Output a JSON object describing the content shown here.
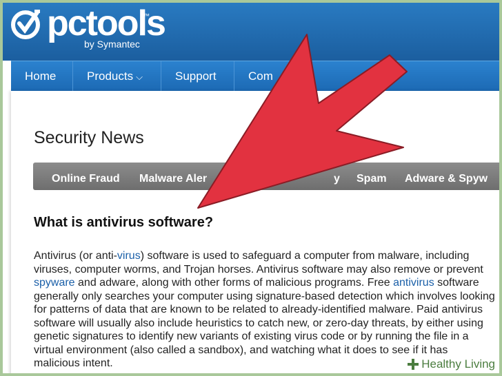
{
  "logo": {
    "name": "pctools",
    "trademark": "™",
    "byline": "by Symantec"
  },
  "nav": {
    "items": [
      {
        "label": "Home"
      },
      {
        "label": "Products"
      },
      {
        "label": "Support"
      },
      {
        "label": "Com"
      }
    ]
  },
  "page": {
    "title": "Security News"
  },
  "tabs": [
    {
      "label": "Online Fraud"
    },
    {
      "label": "Malware Aler"
    },
    {
      "label": "y"
    },
    {
      "label": "Spam"
    },
    {
      "label": "Adware & Spyw"
    }
  ],
  "article": {
    "title": "What is antivirus software?",
    "segments": [
      {
        "text": "Antivirus (or anti-",
        "link": false
      },
      {
        "text": "virus",
        "link": true
      },
      {
        "text": ") software is used to safeguard a computer from malware, including viruses, computer worms, and Trojan horses. Antivirus software may also remove or prevent ",
        "link": false
      },
      {
        "text": "spyware",
        "link": true
      },
      {
        "text": " and adware, along with other forms of malicious programs. Free ",
        "link": false
      },
      {
        "text": "antivirus",
        "link": true
      },
      {
        "text": " software generally only searches your computer using signature-based detection which involves looking for patterns of data that are known to be related to already-identified malware. Paid antivirus software will usually also include heuristics to catch new, or zero-day threats, by either using genetic signatures to identify new variants of existing virus code or by running the file in a virtual environment (also called a sandbox), and watching what it does to see if it has malicious intent.",
        "link": false
      }
    ]
  },
  "watermark": {
    "label": "Healthy Living"
  },
  "colors": {
    "header_blue": "#2a7cc3",
    "nav_blue": "#1c69b3",
    "tab_gray": "#7a7a7a",
    "arrow_red": "#e23240",
    "link_blue": "#1a5fa8"
  }
}
